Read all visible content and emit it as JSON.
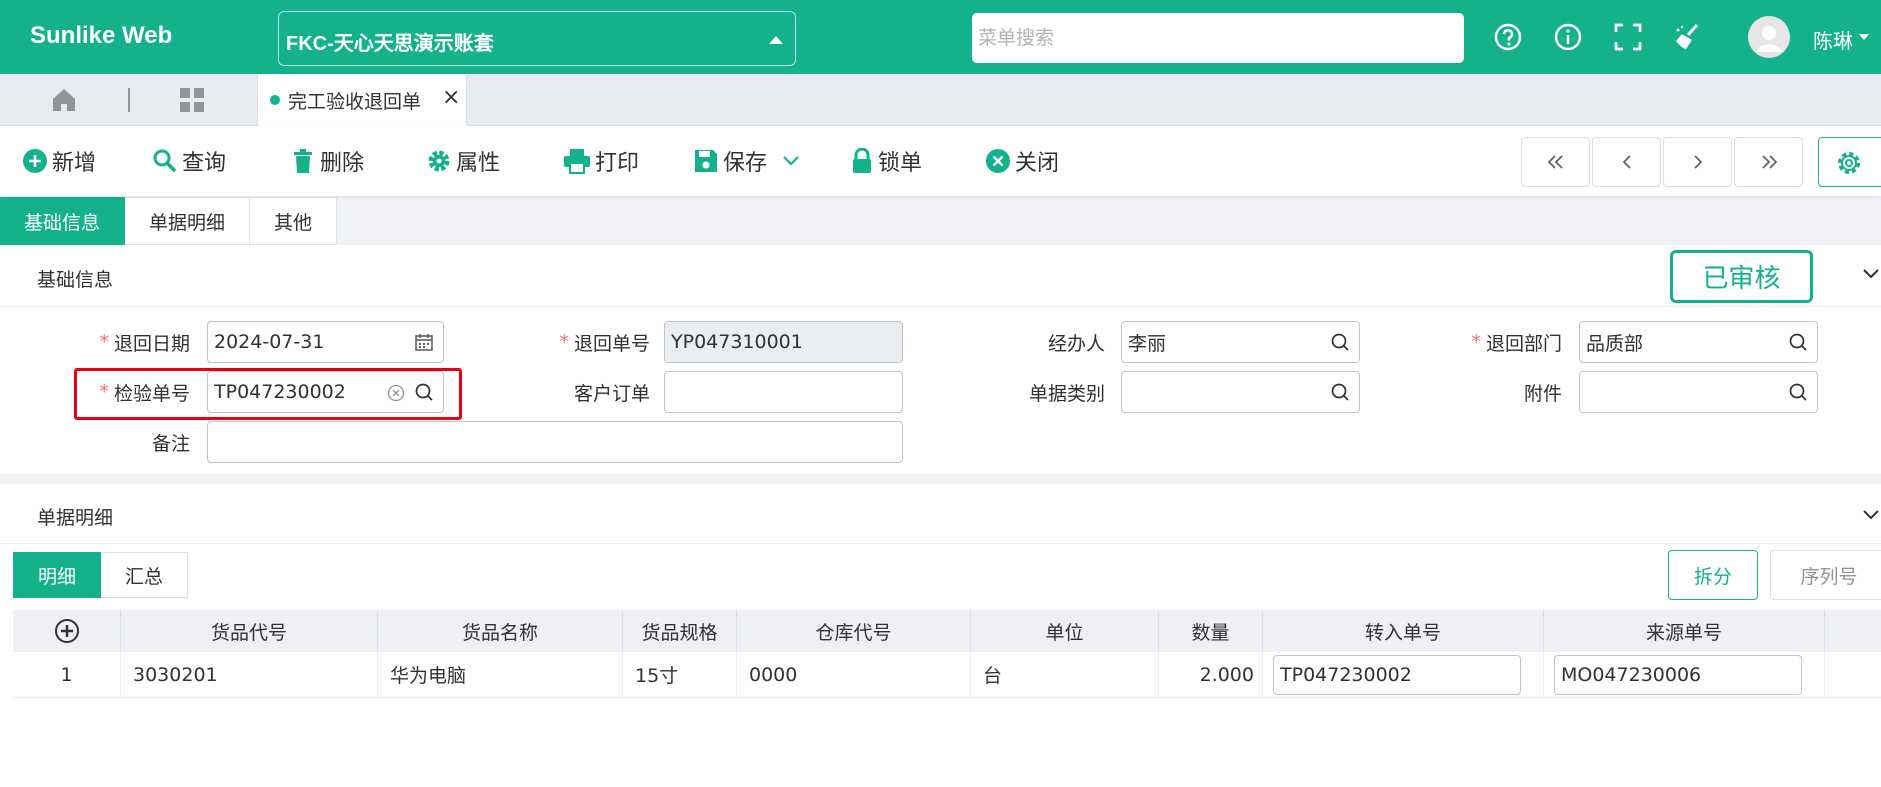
{
  "header": {
    "brand": "Sunlike Web",
    "account": "FKC-天心天思演示账套",
    "search_placeholder": "菜单搜索",
    "user": "陈琳",
    "icons": [
      "help-icon",
      "info-icon",
      "fullscreen-icon",
      "clean-icon"
    ]
  },
  "tabs": {
    "active_doc": "完工验收退回单"
  },
  "toolbar": {
    "add": "新增",
    "query": "查询",
    "delete": "删除",
    "props": "属性",
    "print": "打印",
    "save": "保存",
    "lock": "锁单",
    "close": "关闭"
  },
  "main_tabs": [
    "基础信息",
    "单据明细",
    "其他"
  ],
  "basic": {
    "title": "基础信息",
    "status": "已审核",
    "fields": {
      "return_date": {
        "label": "退回日期",
        "value": "2024-07-31"
      },
      "return_no": {
        "label": "退回单号",
        "value": "YP047310001"
      },
      "handler": {
        "label": "经办人",
        "value": "李丽"
      },
      "return_dept": {
        "label": "退回部门",
        "value": "品质部"
      },
      "inspect_no": {
        "label": "检验单号",
        "value": "TP047230002"
      },
      "cust_order": {
        "label": "客户订单",
        "value": ""
      },
      "doc_type": {
        "label": "单据类别",
        "value": ""
      },
      "attach": {
        "label": "附件",
        "value": ""
      },
      "remark": {
        "label": "备注",
        "value": ""
      }
    }
  },
  "detail": {
    "title": "单据明细",
    "subtabs": [
      "明细",
      "汇总"
    ],
    "split": "拆分",
    "serial": "序列号",
    "columns": [
      "货品代号",
      "货品名称",
      "货品规格",
      "仓库代号",
      "单位",
      "数量",
      "转入单号",
      "来源单号"
    ],
    "rows": [
      {
        "no": "1",
        "code": "3030201",
        "name": "华为电脑",
        "spec": "15寸",
        "wh": "0000",
        "unit": "台",
        "qty": "2.000",
        "in_no": "TP047230002",
        "src_no": "MO047230006"
      }
    ]
  },
  "colors": {
    "brand": "#13b28c",
    "required": "#f56c6c",
    "highlight": "#e60012"
  }
}
